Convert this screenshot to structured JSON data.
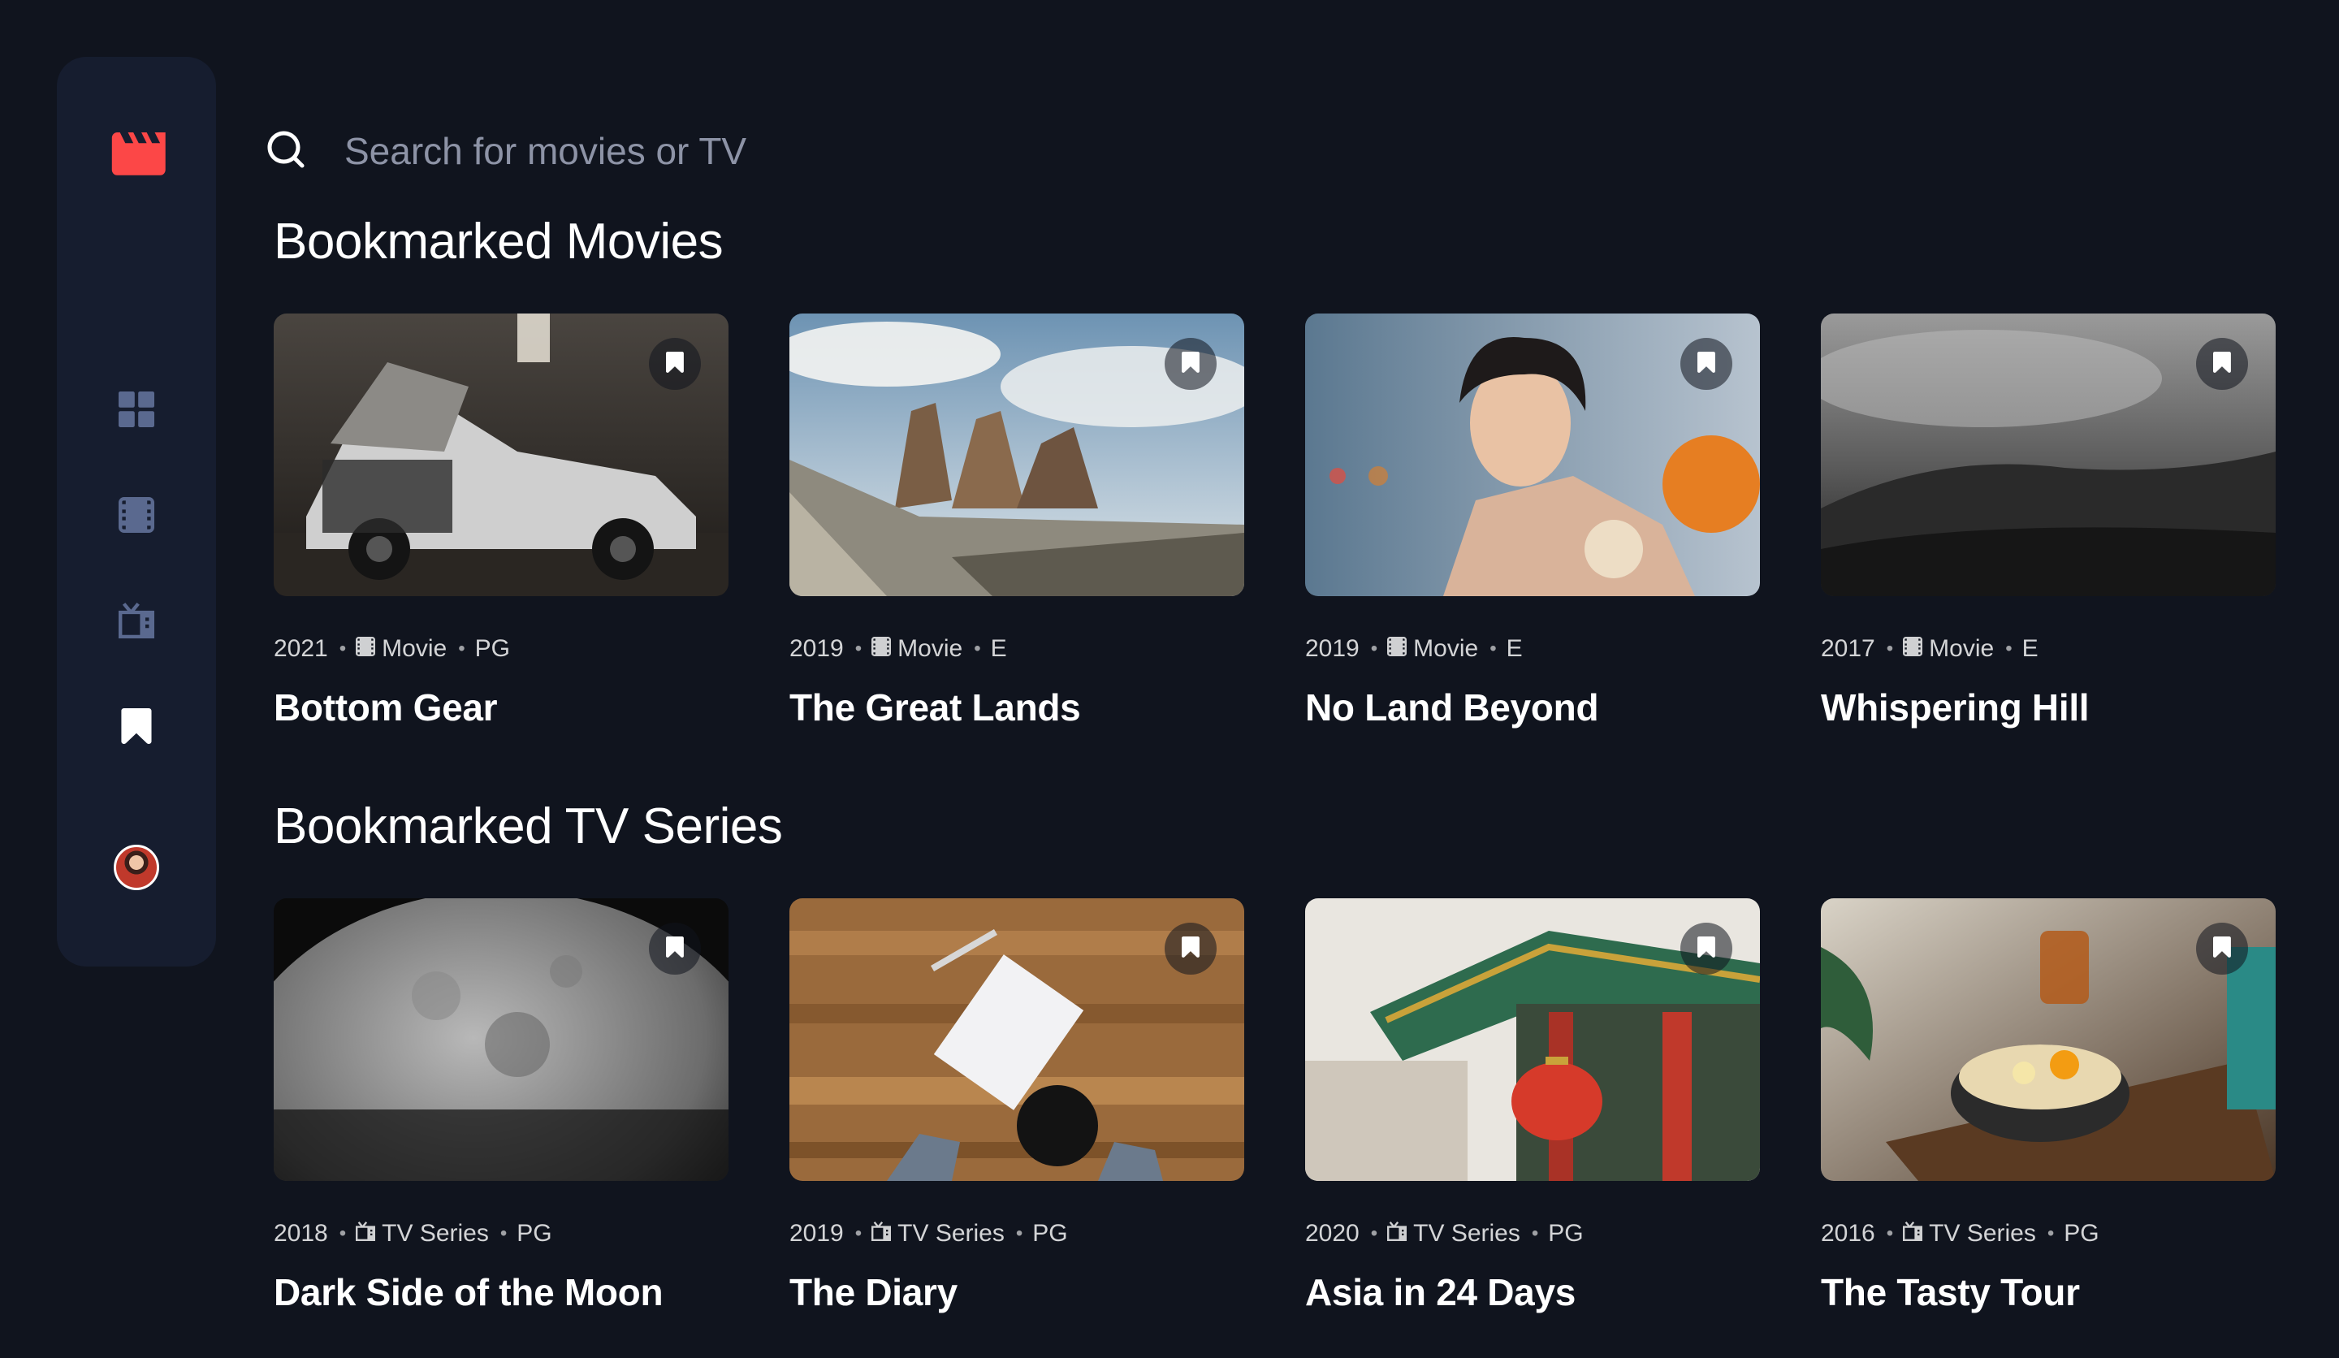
{
  "search": {
    "placeholder": "Search for movies or TV"
  },
  "sidebar": {
    "logo_icon": "clapperboard-icon",
    "items": [
      {
        "name": "home",
        "icon": "grid-icon",
        "active": false
      },
      {
        "name": "movies",
        "icon": "film-icon",
        "active": false
      },
      {
        "name": "tv-series",
        "icon": "tv-icon",
        "active": false
      },
      {
        "name": "bookmarks",
        "icon": "bookmark-icon",
        "active": true
      }
    ]
  },
  "sections": {
    "movies": {
      "title": "Bookmarked Movies",
      "items": [
        {
          "year": "2021",
          "category": "Movie",
          "rating": "PG",
          "title": "Bottom Gear",
          "category_icon": "film-icon"
        },
        {
          "year": "2019",
          "category": "Movie",
          "rating": "E",
          "title": "The Great Lands",
          "category_icon": "film-icon"
        },
        {
          "year": "2019",
          "category": "Movie",
          "rating": "E",
          "title": "No Land Beyond",
          "category_icon": "film-icon"
        },
        {
          "year": "2017",
          "category": "Movie",
          "rating": "E",
          "title": "Whispering Hill",
          "category_icon": "film-icon"
        }
      ]
    },
    "series": {
      "title": "Bookmarked TV Series",
      "items": [
        {
          "year": "2018",
          "category": "TV Series",
          "rating": "PG",
          "title": "Dark Side of the Moon",
          "category_icon": "tv-icon"
        },
        {
          "year": "2019",
          "category": "TV Series",
          "rating": "PG",
          "title": "The Diary",
          "category_icon": "tv-icon"
        },
        {
          "year": "2020",
          "category": "TV Series",
          "rating": "PG",
          "title": "Asia in 24 Days",
          "category_icon": "tv-icon"
        },
        {
          "year": "2016",
          "category": "TV Series",
          "rating": "PG",
          "title": "The Tasty Tour",
          "category_icon": "tv-icon"
        }
      ]
    }
  },
  "colors": {
    "background": "#10141E",
    "sidebar": "#161D2F",
    "accent": "#FC4747",
    "icon_inactive": "#5A698F",
    "text_muted": "#8D93A6"
  }
}
